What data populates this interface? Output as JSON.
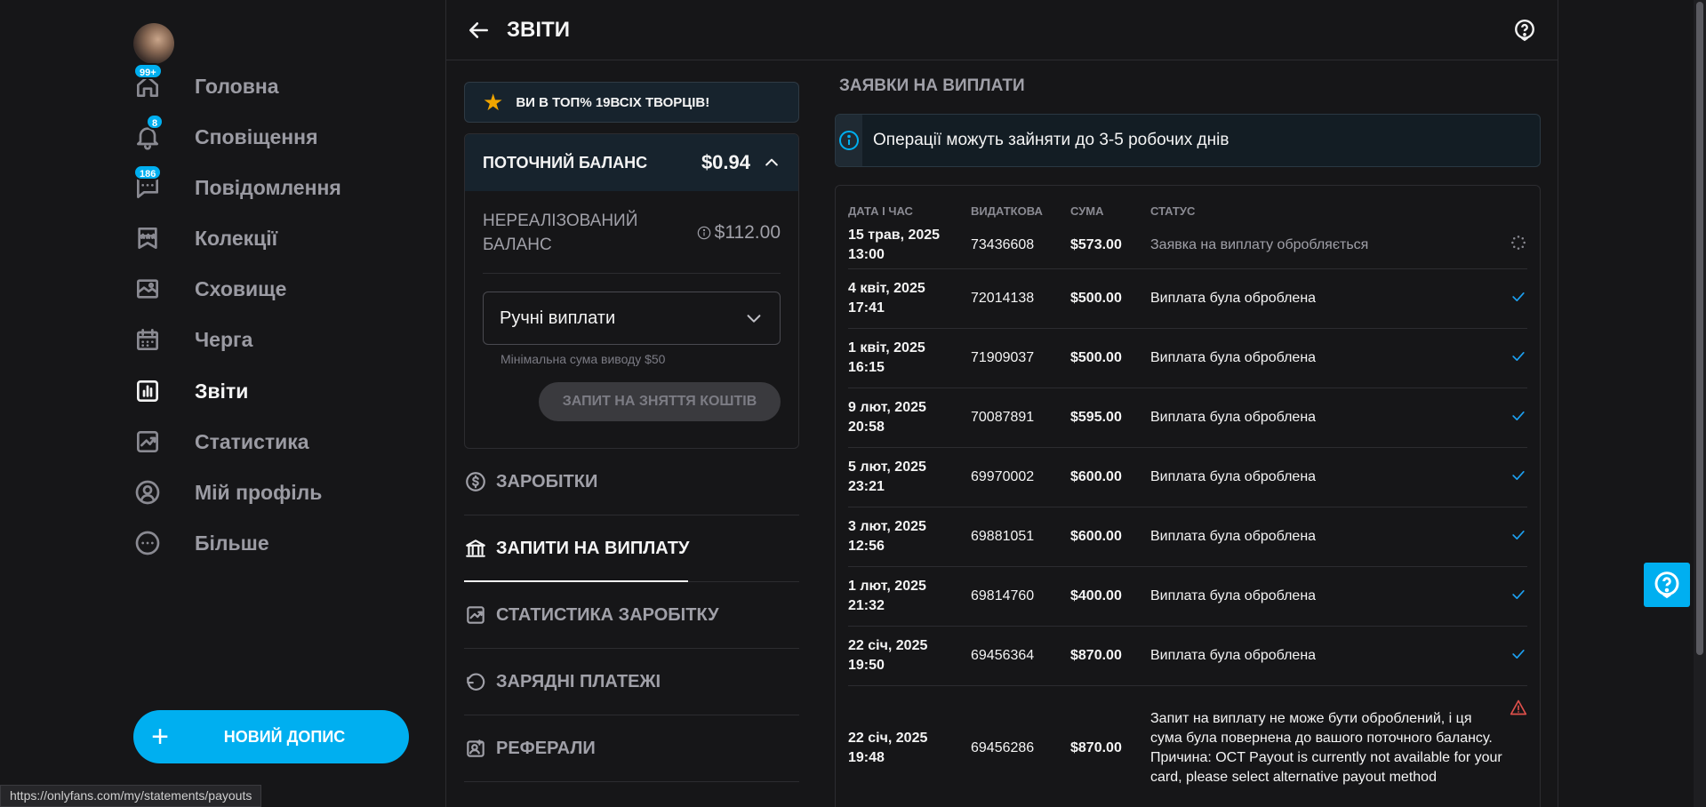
{
  "sidebar": {
    "avatar_alt": "profile avatar",
    "items": [
      {
        "label": "Головна",
        "badge": "99+",
        "icon": "home-icon"
      },
      {
        "label": "Сповіщення",
        "badge": "8",
        "icon": "bell-icon"
      },
      {
        "label": "Повідомлення",
        "badge": "186",
        "icon": "message-icon"
      },
      {
        "label": "Колекції",
        "badge": "",
        "icon": "collections-icon"
      },
      {
        "label": "Сховище",
        "badge": "",
        "icon": "vault-icon"
      },
      {
        "label": "Черга",
        "badge": "",
        "icon": "calendar-icon"
      },
      {
        "label": "Звіти",
        "badge": "",
        "icon": "statements-icon",
        "active": true
      },
      {
        "label": "Статистика",
        "badge": "",
        "icon": "stats-icon"
      },
      {
        "label": "Мій профіль",
        "badge": "",
        "icon": "profile-icon"
      },
      {
        "label": "Більше",
        "badge": "",
        "icon": "more-icon"
      }
    ],
    "new_post_label": "НОВИЙ ДОПИС"
  },
  "status_url": "https://onlyfans.com/my/statements/payouts",
  "header": {
    "title": "ЗВІТИ"
  },
  "left_panel": {
    "top_banner": "ВИ В ТОП% 19ВСІХ ТВОРЦІВ!",
    "balance": {
      "label": "ПОТОЧНИЙ БАЛАНС",
      "value": "$0.94",
      "unrealized_label": "НЕРЕАЛІЗОВАНИЙ БАЛАНС",
      "unrealized_value": "$112.00",
      "payout_mode": "Ручні виплати",
      "min_note": "Мінімальна сума виводу $50",
      "withdraw_button": "ЗАПИТ НА ЗНЯТТЯ КОШТІВ"
    },
    "menu": [
      {
        "label": "ЗАРОБІТКИ",
        "icon": "dollar-circle-icon"
      },
      {
        "label": "ЗАПИТИ НА ВИПЛАТУ",
        "icon": "bank-icon",
        "active": true
      },
      {
        "label": "СТАТИСТИКА ЗАРОБІТКУ",
        "icon": "chart-icon"
      },
      {
        "label": "ЗАРЯДНІ ПЛАТЕЖІ",
        "icon": "refund-icon"
      },
      {
        "label": "РЕФЕРАЛИ",
        "icon": "referral-icon"
      }
    ]
  },
  "payouts": {
    "section_title": "ЗАЯВКИ НА ВИПЛАТИ",
    "info_text": "Операції можуть зайняти до 3-5 робочих днів",
    "columns": [
      "ДАТА І ЧАС",
      "ВИДАТКОВА",
      "СУМА",
      "СТАТУС"
    ],
    "rows": [
      {
        "date": "15 трав, 2025",
        "time": "13:00",
        "id": "73436608",
        "amount": "$573.00",
        "status": "Заявка на виплату обробляється",
        "state": "pending"
      },
      {
        "date": "4 квіт, 2025",
        "time": "17:41",
        "id": "72014138",
        "amount": "$500.00",
        "status": "Виплата була оброблена",
        "state": "done"
      },
      {
        "date": "1 квіт, 2025",
        "time": "16:15",
        "id": "71909037",
        "amount": "$500.00",
        "status": "Виплата була оброблена",
        "state": "done"
      },
      {
        "date": "9 лют, 2025",
        "time": "20:58",
        "id": "70087891",
        "amount": "$595.00",
        "status": "Виплата була оброблена",
        "state": "done"
      },
      {
        "date": "5 лют, 2025",
        "time": "23:21",
        "id": "69970002",
        "amount": "$600.00",
        "status": "Виплата була оброблена",
        "state": "done"
      },
      {
        "date": "3 лют, 2025",
        "time": "12:56",
        "id": "69881051",
        "amount": "$600.00",
        "status": "Виплата була оброблена",
        "state": "done"
      },
      {
        "date": "1 лют, 2025",
        "time": "21:32",
        "id": "69814760",
        "amount": "$400.00",
        "status": "Виплата була оброблена",
        "state": "done"
      },
      {
        "date": "22 січ, 2025",
        "time": "19:50",
        "id": "69456364",
        "amount": "$870.00",
        "status": "Виплата була оброблена",
        "state": "done"
      },
      {
        "date": "22 січ, 2025",
        "time": "19:48",
        "id": "69456286",
        "amount": "$870.00",
        "status": "Запит на виплату не може бути оброблений, і ця сума була повернена до вашого поточного балансу.",
        "reason": "Причина: OCT Payout is currently not available for your card, please select alternative payout method",
        "state": "failed"
      }
    ]
  },
  "colors": {
    "accent": "#00aff0",
    "background": "#161618",
    "success": "#1da1f2",
    "error": "#e0504b",
    "star": "#f0a500"
  }
}
